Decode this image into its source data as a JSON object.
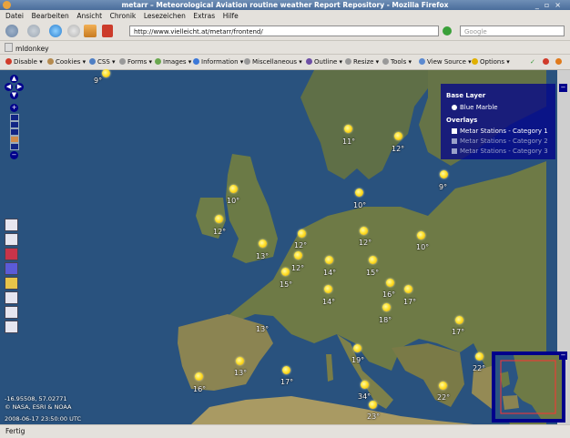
{
  "window": {
    "title": "metarr – Meteorological Aviation routine weather Report Repository - Mozilla Firefox",
    "controls": [
      "_",
      "▫",
      "×"
    ]
  },
  "menu": [
    "Datei",
    "Bearbeiten",
    "Ansicht",
    "Chronik",
    "Lesezeichen",
    "Extras",
    "Hilfe"
  ],
  "nav": {
    "url": "http://www.vielleicht.at/metarr/frontend/",
    "search_placeholder": "Google"
  },
  "bookmarks": [
    "mldonkey"
  ],
  "devtoolbar": {
    "items": [
      "Disable",
      "Cookies",
      "CSS",
      "Forms",
      "Images",
      "Information",
      "Miscellaneous",
      "Outline",
      "Resize",
      "Tools",
      "View Source",
      "Options"
    ]
  },
  "layers": {
    "base_heading": "Base Layer",
    "base": "Blue Marble",
    "overlays_heading": "Overlays",
    "overlays": [
      "Metar Stations - Category 1",
      "Metar Stations - Category 2",
      "Metar Stations - Category 3"
    ]
  },
  "stations": [
    "9°",
    "11°",
    "12°",
    "9°",
    "10°",
    "10°",
    "12°",
    "12°",
    "12°",
    "10°",
    "13°",
    "12°",
    "14°",
    "15°",
    "15°",
    "16°",
    "14°",
    "18°",
    "17°",
    "13°",
    "17°",
    "19°",
    "16°",
    "13°",
    "17°",
    "22°",
    "34°",
    "22°",
    "23°"
  ],
  "readouts": {
    "coords": "-16.95508, 57.02771",
    "credit": "© NASA, ESRI & NOAA",
    "timestamp": "2008-06-17 23:50:00 UTC"
  },
  "status": "Fertig",
  "colors": {
    "sea": "#29527e",
    "land": "#6e7d4a",
    "panel": "#00008b",
    "marker": "#ffe22e"
  }
}
